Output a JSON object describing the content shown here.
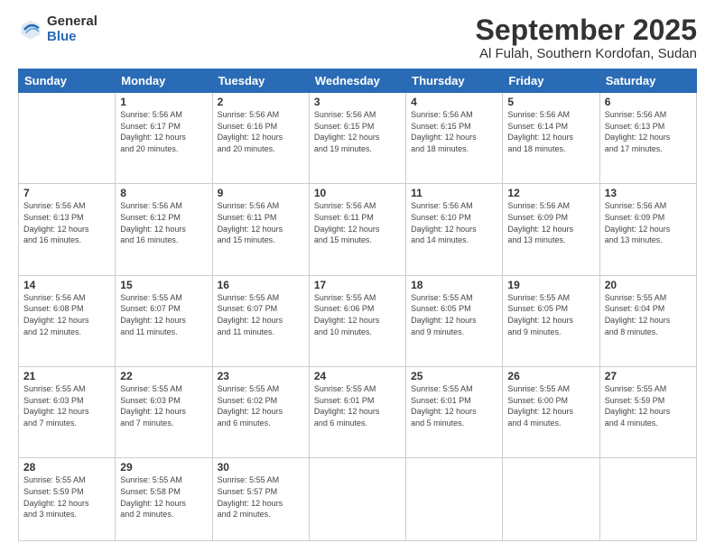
{
  "logo": {
    "general": "General",
    "blue": "Blue"
  },
  "header": {
    "month": "September 2025",
    "location": "Al Fulah, Southern Kordofan, Sudan"
  },
  "weekdays": [
    "Sunday",
    "Monday",
    "Tuesday",
    "Wednesday",
    "Thursday",
    "Friday",
    "Saturday"
  ],
  "weeks": [
    [
      {
        "day": "",
        "info": ""
      },
      {
        "day": "1",
        "info": "Sunrise: 5:56 AM\nSunset: 6:17 PM\nDaylight: 12 hours\nand 20 minutes."
      },
      {
        "day": "2",
        "info": "Sunrise: 5:56 AM\nSunset: 6:16 PM\nDaylight: 12 hours\nand 20 minutes."
      },
      {
        "day": "3",
        "info": "Sunrise: 5:56 AM\nSunset: 6:15 PM\nDaylight: 12 hours\nand 19 minutes."
      },
      {
        "day": "4",
        "info": "Sunrise: 5:56 AM\nSunset: 6:15 PM\nDaylight: 12 hours\nand 18 minutes."
      },
      {
        "day": "5",
        "info": "Sunrise: 5:56 AM\nSunset: 6:14 PM\nDaylight: 12 hours\nand 18 minutes."
      },
      {
        "day": "6",
        "info": "Sunrise: 5:56 AM\nSunset: 6:13 PM\nDaylight: 12 hours\nand 17 minutes."
      }
    ],
    [
      {
        "day": "7",
        "info": "Sunrise: 5:56 AM\nSunset: 6:13 PM\nDaylight: 12 hours\nand 16 minutes."
      },
      {
        "day": "8",
        "info": "Sunrise: 5:56 AM\nSunset: 6:12 PM\nDaylight: 12 hours\nand 16 minutes."
      },
      {
        "day": "9",
        "info": "Sunrise: 5:56 AM\nSunset: 6:11 PM\nDaylight: 12 hours\nand 15 minutes."
      },
      {
        "day": "10",
        "info": "Sunrise: 5:56 AM\nSunset: 6:11 PM\nDaylight: 12 hours\nand 15 minutes."
      },
      {
        "day": "11",
        "info": "Sunrise: 5:56 AM\nSunset: 6:10 PM\nDaylight: 12 hours\nand 14 minutes."
      },
      {
        "day": "12",
        "info": "Sunrise: 5:56 AM\nSunset: 6:09 PM\nDaylight: 12 hours\nand 13 minutes."
      },
      {
        "day": "13",
        "info": "Sunrise: 5:56 AM\nSunset: 6:09 PM\nDaylight: 12 hours\nand 13 minutes."
      }
    ],
    [
      {
        "day": "14",
        "info": "Sunrise: 5:56 AM\nSunset: 6:08 PM\nDaylight: 12 hours\nand 12 minutes."
      },
      {
        "day": "15",
        "info": "Sunrise: 5:55 AM\nSunset: 6:07 PM\nDaylight: 12 hours\nand 11 minutes."
      },
      {
        "day": "16",
        "info": "Sunrise: 5:55 AM\nSunset: 6:07 PM\nDaylight: 12 hours\nand 11 minutes."
      },
      {
        "day": "17",
        "info": "Sunrise: 5:55 AM\nSunset: 6:06 PM\nDaylight: 12 hours\nand 10 minutes."
      },
      {
        "day": "18",
        "info": "Sunrise: 5:55 AM\nSunset: 6:05 PM\nDaylight: 12 hours\nand 9 minutes."
      },
      {
        "day": "19",
        "info": "Sunrise: 5:55 AM\nSunset: 6:05 PM\nDaylight: 12 hours\nand 9 minutes."
      },
      {
        "day": "20",
        "info": "Sunrise: 5:55 AM\nSunset: 6:04 PM\nDaylight: 12 hours\nand 8 minutes."
      }
    ],
    [
      {
        "day": "21",
        "info": "Sunrise: 5:55 AM\nSunset: 6:03 PM\nDaylight: 12 hours\nand 7 minutes."
      },
      {
        "day": "22",
        "info": "Sunrise: 5:55 AM\nSunset: 6:03 PM\nDaylight: 12 hours\nand 7 minutes."
      },
      {
        "day": "23",
        "info": "Sunrise: 5:55 AM\nSunset: 6:02 PM\nDaylight: 12 hours\nand 6 minutes."
      },
      {
        "day": "24",
        "info": "Sunrise: 5:55 AM\nSunset: 6:01 PM\nDaylight: 12 hours\nand 6 minutes."
      },
      {
        "day": "25",
        "info": "Sunrise: 5:55 AM\nSunset: 6:01 PM\nDaylight: 12 hours\nand 5 minutes."
      },
      {
        "day": "26",
        "info": "Sunrise: 5:55 AM\nSunset: 6:00 PM\nDaylight: 12 hours\nand 4 minutes."
      },
      {
        "day": "27",
        "info": "Sunrise: 5:55 AM\nSunset: 5:59 PM\nDaylight: 12 hours\nand 4 minutes."
      }
    ],
    [
      {
        "day": "28",
        "info": "Sunrise: 5:55 AM\nSunset: 5:59 PM\nDaylight: 12 hours\nand 3 minutes."
      },
      {
        "day": "29",
        "info": "Sunrise: 5:55 AM\nSunset: 5:58 PM\nDaylight: 12 hours\nand 2 minutes."
      },
      {
        "day": "30",
        "info": "Sunrise: 5:55 AM\nSunset: 5:57 PM\nDaylight: 12 hours\nand 2 minutes."
      },
      {
        "day": "",
        "info": ""
      },
      {
        "day": "",
        "info": ""
      },
      {
        "day": "",
        "info": ""
      },
      {
        "day": "",
        "info": ""
      }
    ]
  ]
}
